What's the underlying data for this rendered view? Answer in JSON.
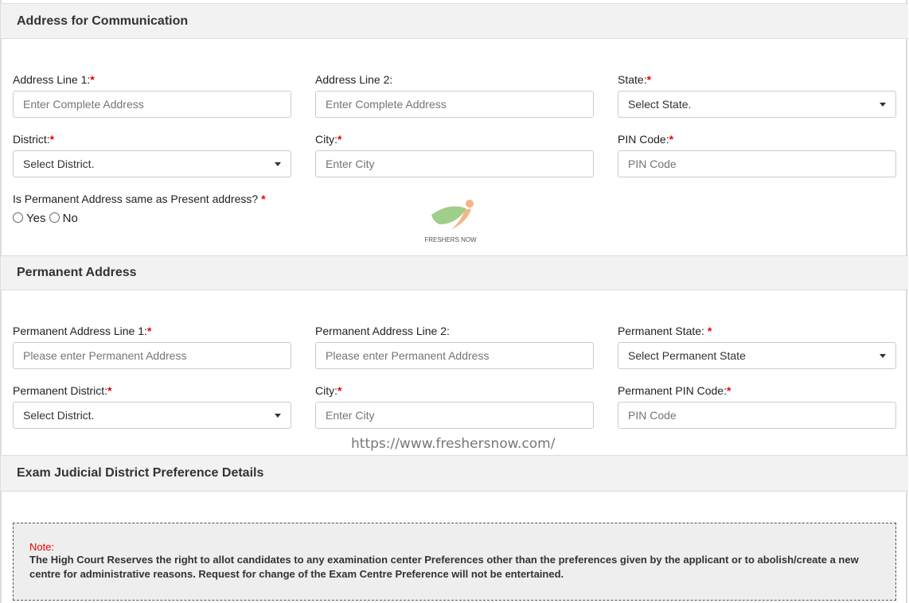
{
  "sections": {
    "communication": {
      "title": "Address for Communication",
      "address_line1": {
        "label": "Address Line 1:",
        "required": "*",
        "placeholder": "Enter Complete Address"
      },
      "address_line2": {
        "label": "Address Line 2:",
        "placeholder": "Enter Complete Address"
      },
      "state": {
        "label": "State:",
        "required": "*",
        "value": "Select State."
      },
      "district": {
        "label": "District:",
        "required": "*",
        "value": "Select District."
      },
      "city": {
        "label": "City:",
        "required": "*",
        "placeholder": "Enter City"
      },
      "pin": {
        "label": "PIN Code:",
        "required": "*",
        "placeholder": "PIN Code"
      },
      "same_question": {
        "label": "Is Permanent Address same as Present address?",
        "required": "*",
        "yes": "Yes",
        "no": "No"
      }
    },
    "permanent": {
      "title": "Permanent Address",
      "address_line1": {
        "label": "Permanent Address Line 1:",
        "required": "*",
        "placeholder": "Please enter Permanent Address"
      },
      "address_line2": {
        "label": "Permanent Address Line 2:",
        "placeholder": "Please enter Permanent Address"
      },
      "state": {
        "label": "Permanent State: ",
        "required": "*",
        "value": "Select Permanent State"
      },
      "district": {
        "label": "Permanent District:",
        "required": "*",
        "value": "Select District."
      },
      "city": {
        "label": "City:",
        "required": "*",
        "placeholder": "Enter City"
      },
      "pin": {
        "label": "Permanent PIN Code:",
        "required": "*",
        "placeholder": "PIN Code"
      }
    },
    "exam": {
      "title": "Exam Judicial District Preference Details",
      "note_title": "Note:",
      "note_text": "The High Court Reserves the right to allot candidates to any examination center Preferences other than the preferences given by the applicant or to abolish/create a new centre for administrative reasons. Request for change of the Exam Centre Preference will not be entertained."
    }
  },
  "watermark": {
    "logo_text": "FRESHERS NOW",
    "url": "https://www.freshersnow.com/"
  },
  "colors": {
    "required": "#ee0000",
    "header_bg": "#f2f2f2"
  }
}
